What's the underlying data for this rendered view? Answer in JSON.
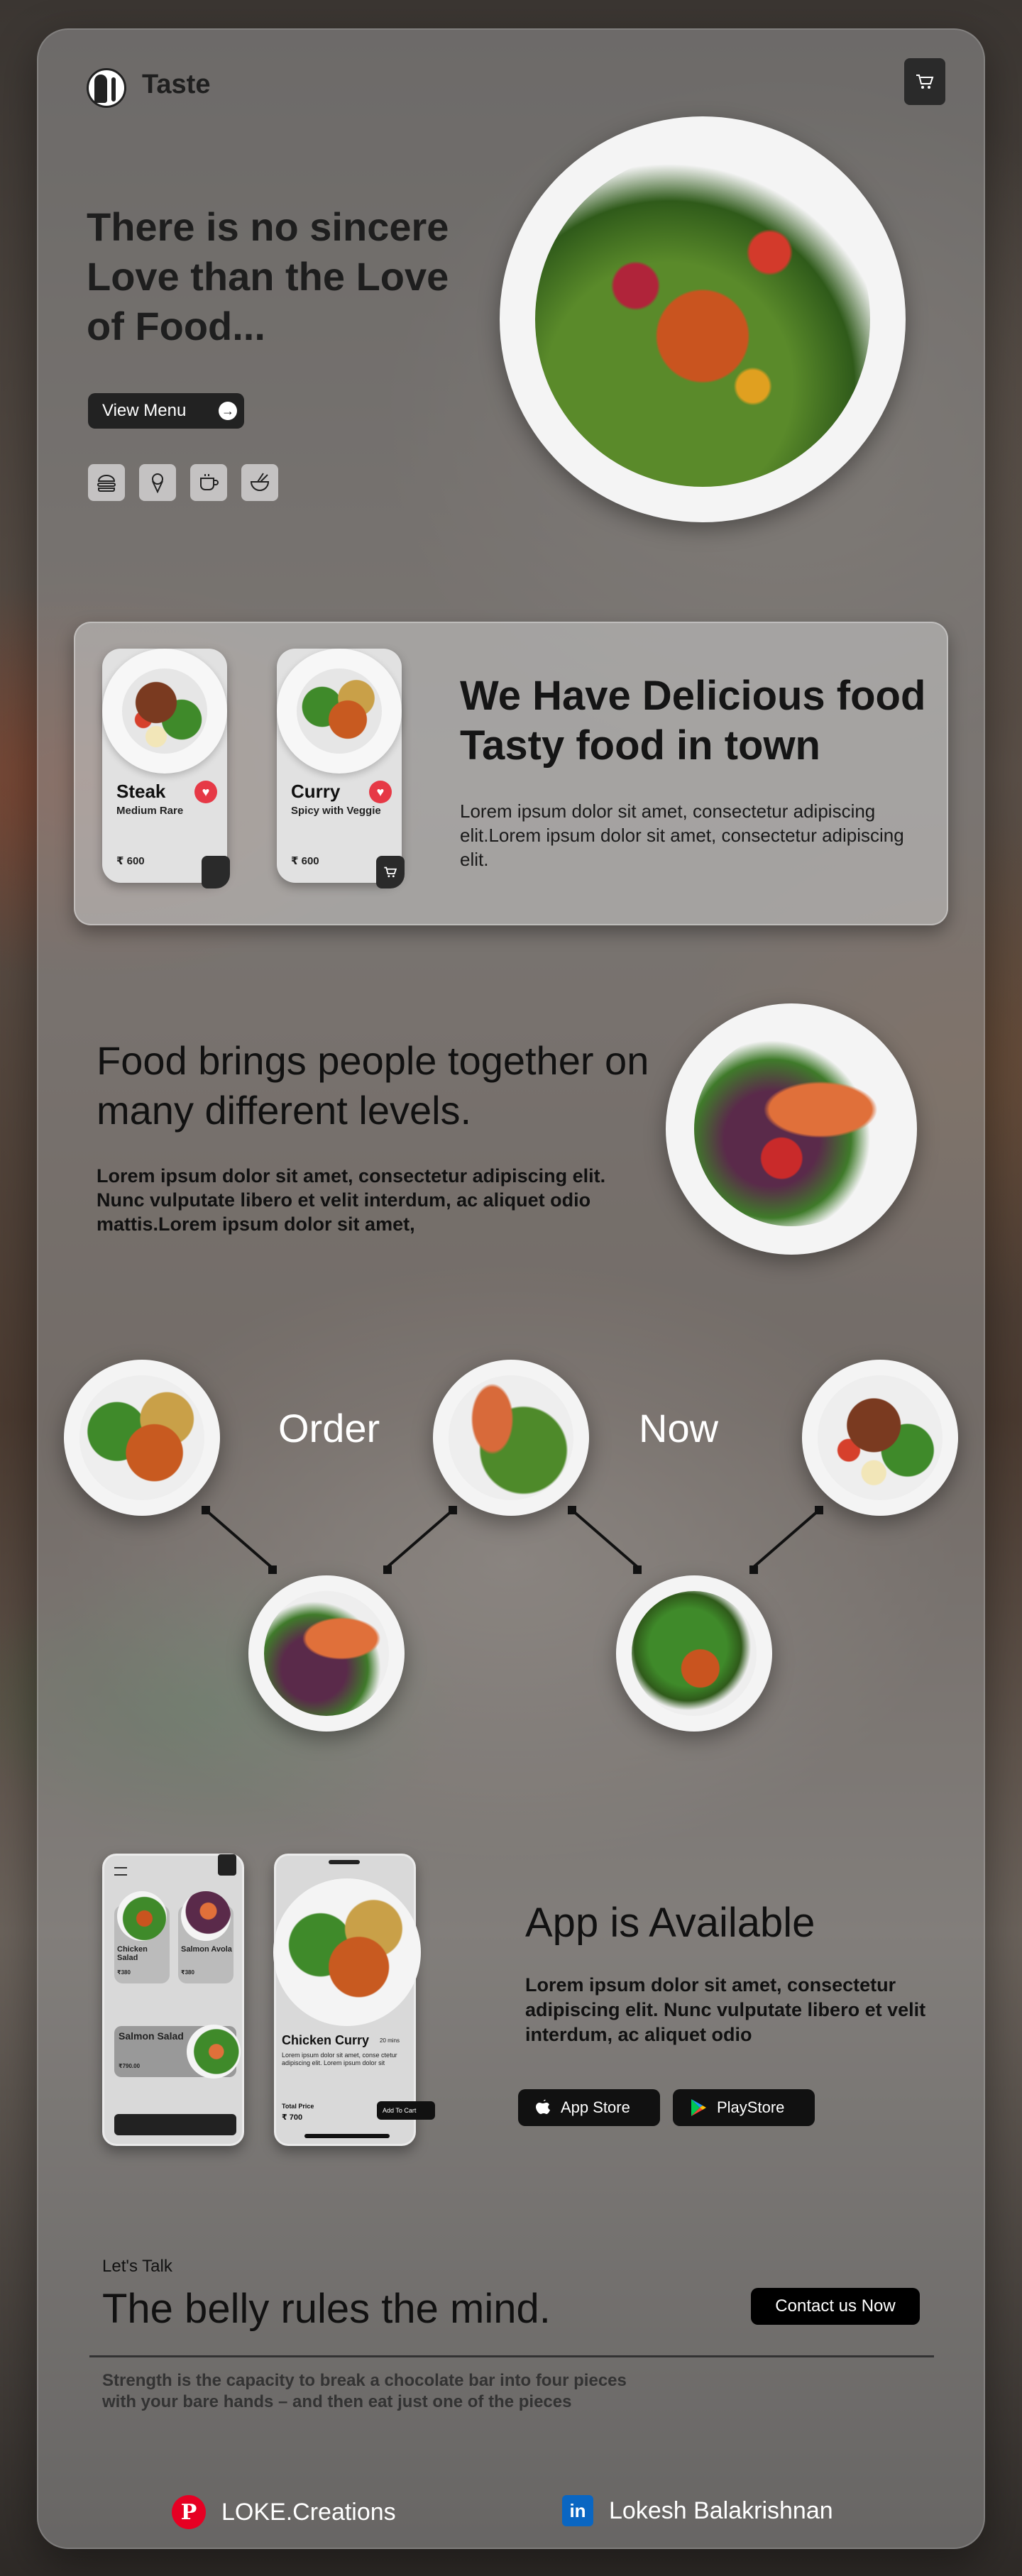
{
  "header": {
    "brand": "Taste"
  },
  "hero": {
    "title": "There is no sincere Love than the Love of Food...",
    "view_menu": "View Menu",
    "categories": [
      "burger-icon",
      "ice-cream-icon",
      "coffee-icon",
      "noodles-icon"
    ]
  },
  "cards": [
    {
      "name": "Steak",
      "subtitle": "Medium Rare",
      "price": "₹ 600"
    },
    {
      "name": "Curry",
      "subtitle": "Spicy with Veggie",
      "price": "₹ 600"
    }
  ],
  "delicious": {
    "title": "We Have Delicious food Tasty food in town",
    "body": "Lorem ipsum dolor sit amet, consectetur adipiscing elit.Lorem ipsum dolor sit amet, consectetur adipiscing elit."
  },
  "together": {
    "title": "Food brings people together on many different levels.",
    "body": "Lorem ipsum dolor sit amet, consectetur adipiscing elit. Nunc vulputate libero et velit interdum, ac aliquet odio mattis.Lorem ipsum dolor sit amet,"
  },
  "order": {
    "word1": "Order",
    "word2": "Now"
  },
  "app": {
    "title": "App is Available",
    "body": "Lorem ipsum dolor sit amet, consectetur adipiscing elit. Nunc vulputate libero et velit interdum, ac aliquet odio",
    "app_store": "App Store",
    "play_store": "PlayStore",
    "phone1": {
      "items": [
        {
          "name": "Chicken Salad",
          "price": "₹380"
        },
        {
          "name": "Salmon Avola",
          "price": "₹380"
        }
      ],
      "featured": "Salmon Salad",
      "featured_price": "₹790.00"
    },
    "phone2": {
      "title": "Chicken Curry",
      "time": "20 mins",
      "desc": "Lorem ipsum dolor sit amet, conse ctetur adipiscing elit. Lorem ipsum dolor sit",
      "total_label": "Total Price",
      "total": "₹ 700",
      "add_to_cart": "Add To Cart"
    }
  },
  "talk": {
    "label": "Let's Talk",
    "title": "The belly rules the mind.",
    "contact": "Contact us Now",
    "body": "Strength is the capacity to break a chocolate bar into four pieces with your bare hands – and then eat just one of the pieces"
  },
  "social": {
    "pinterest": "LOKE.Creations",
    "linkedin": "Lokesh Balakrishnan"
  }
}
